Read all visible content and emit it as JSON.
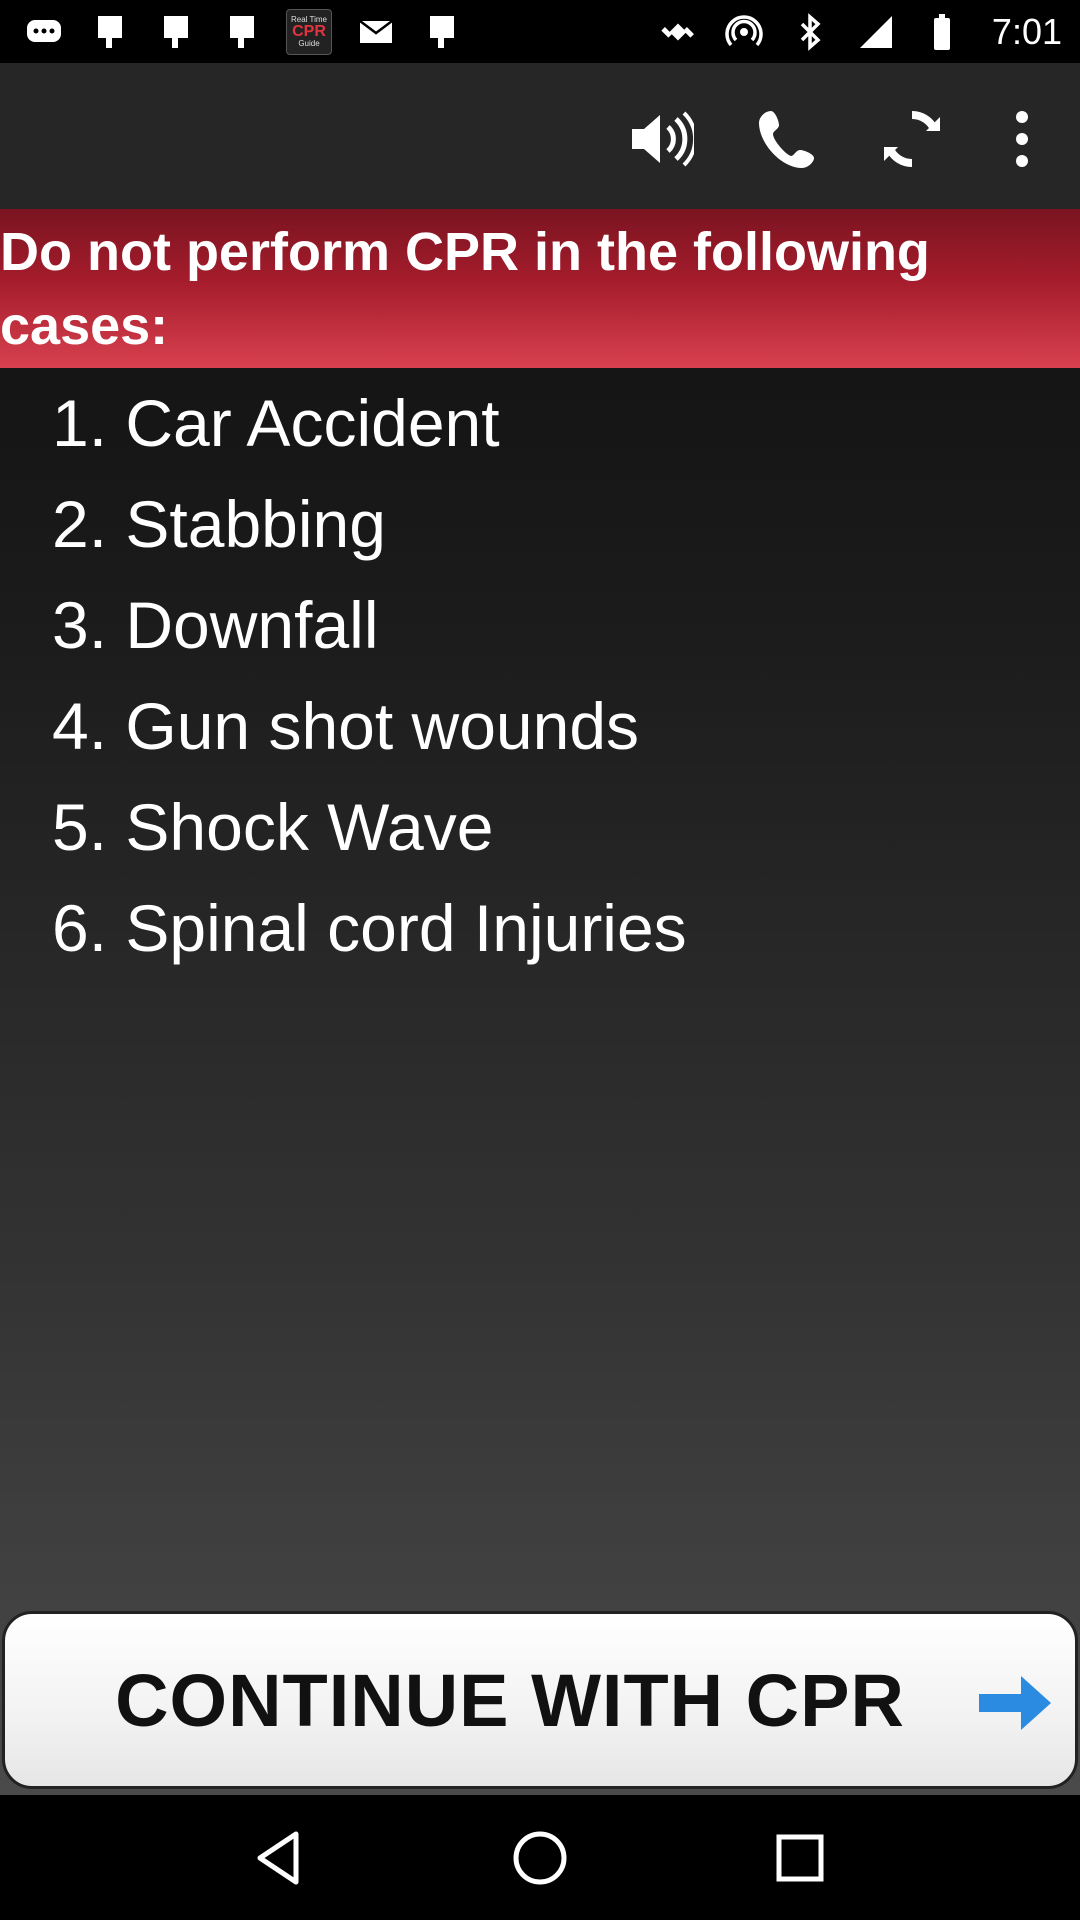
{
  "status_bar": {
    "app_badge_small": "Real Time",
    "app_badge_big": "CPR",
    "app_badge_small2": "Guide",
    "time": "7:01",
    "left_icons": [
      "message-icon",
      "flag-icon",
      "flag-icon",
      "flag-icon",
      "cpr-app-icon",
      "mail-icon",
      "flag-icon"
    ],
    "right_icons": [
      "fake-gps-icon",
      "hotspot-icon",
      "bluetooth-icon",
      "signal-icon",
      "battery-icon"
    ]
  },
  "action_bar": {
    "icons": [
      "volume-icon",
      "phone-icon",
      "refresh-icon",
      "more-vert-icon"
    ]
  },
  "warning": {
    "text": "Do not perform CPR in the following cases:"
  },
  "cases": [
    "1. Car Accident",
    "2. Stabbing",
    "3. Downfall",
    "4. Gun shot wounds",
    "5. Shock Wave",
    "6. Spinal cord Injuries"
  ],
  "continue_button": {
    "label": "CONTINUE WITH CPR",
    "arrow_color": "#2a8be0"
  },
  "colors": {
    "warning_top": "#7a1420",
    "warning_bottom": "#d8414f",
    "action_bar": "#262626"
  }
}
